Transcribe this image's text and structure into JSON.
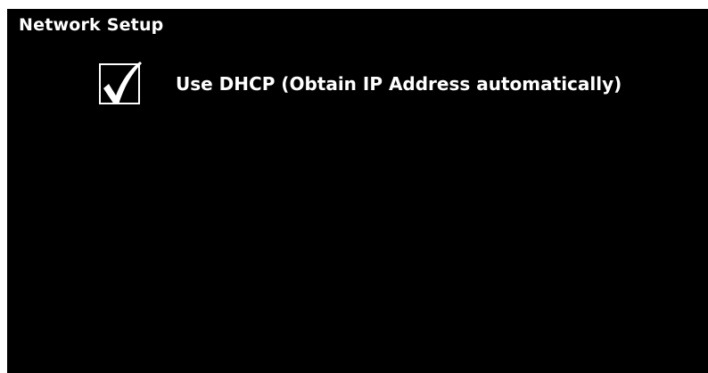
{
  "window": {
    "title": "Network Setup"
  },
  "options": [
    {
      "label": "Use DHCP (Obtain IP Address automatically)",
      "checked": true,
      "icon": "checkmark-icon"
    }
  ],
  "colors": {
    "background": "#000000",
    "foreground": "#ffffff"
  }
}
